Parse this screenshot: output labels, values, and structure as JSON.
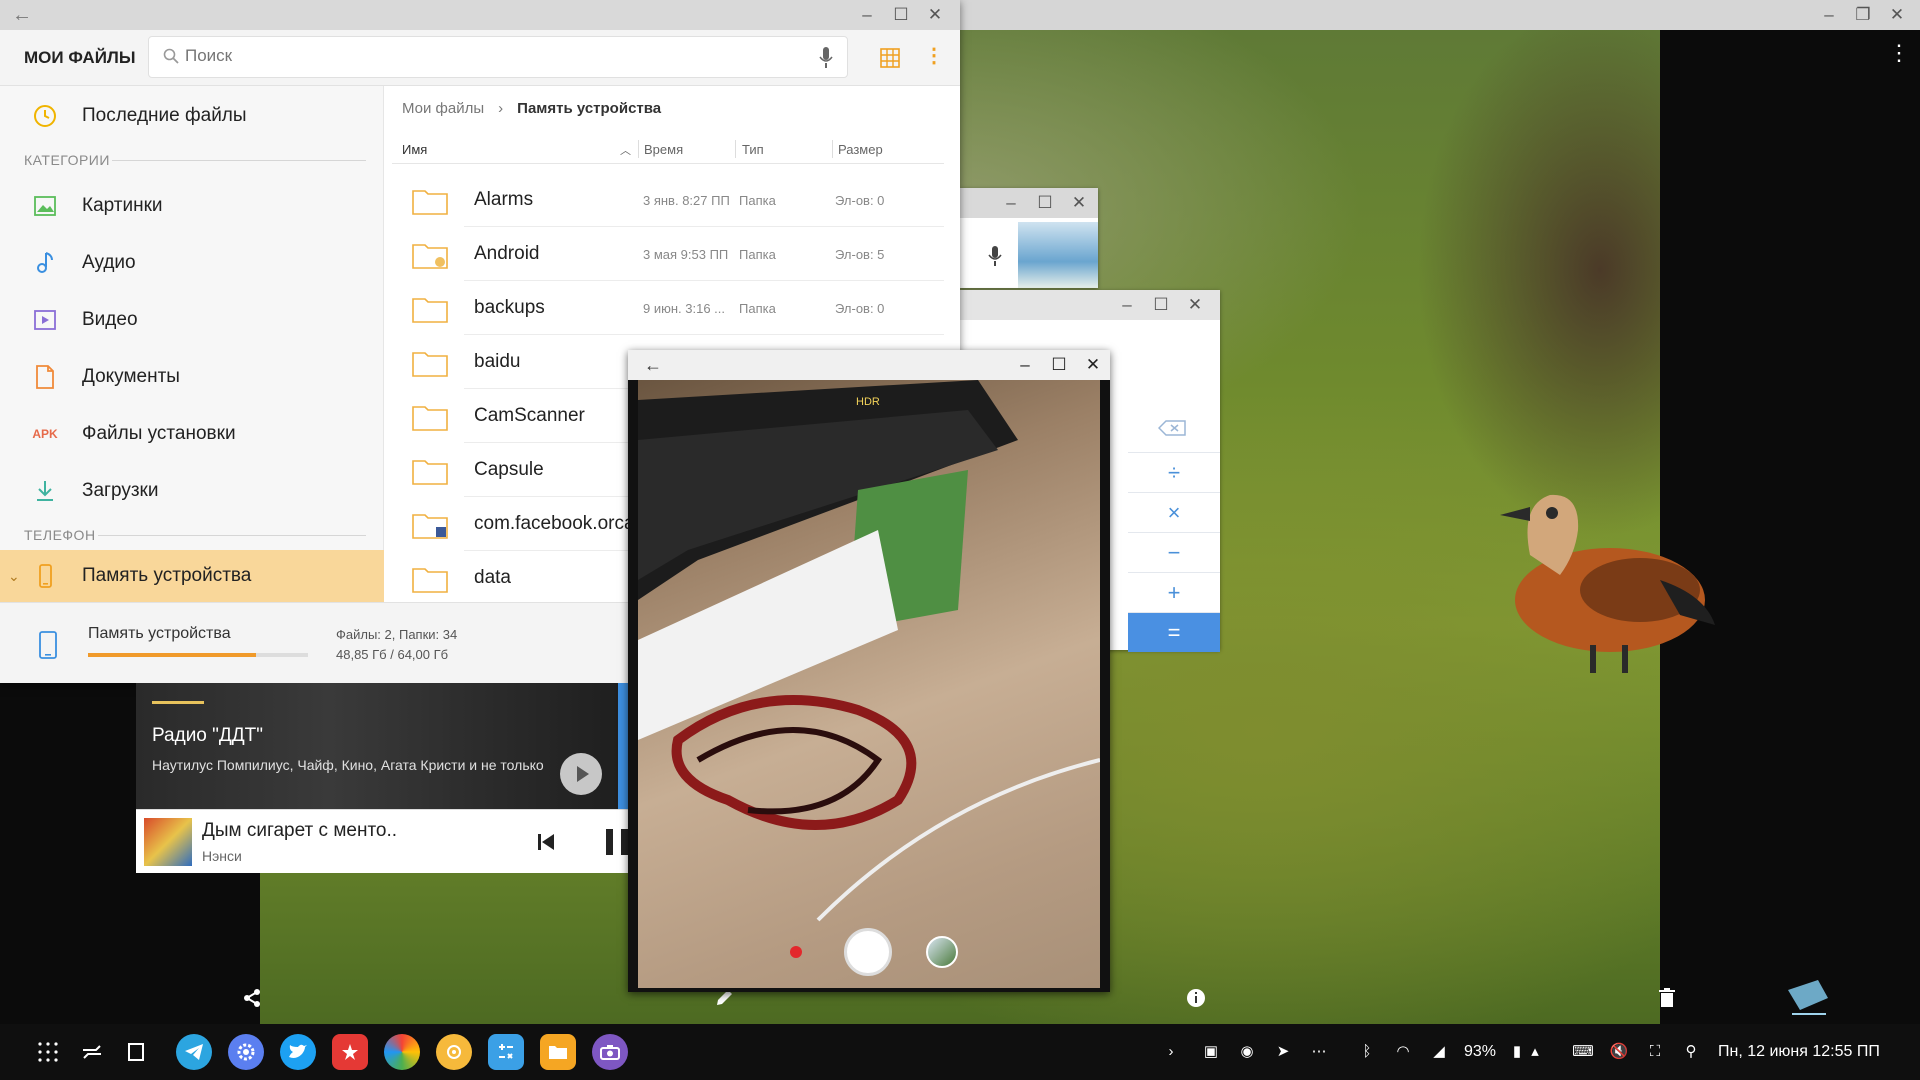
{
  "my_files": {
    "title": "МОИ ФАЙЛЫ",
    "search_placeholder": "Поиск",
    "sidebar": {
      "recent": "Последние файлы",
      "categories_header": "КАТЕГОРИИ",
      "categories": [
        "Картинки",
        "Аудио",
        "Видео",
        "Документы",
        "Файлы установки",
        "Загрузки"
      ],
      "apk_badge": "APK",
      "phone_header": "ТЕЛЕФОН",
      "device_storage": "Память устройства"
    },
    "breadcrumb": [
      "Мои файлы",
      "Память устройства"
    ],
    "columns": {
      "name": "Имя",
      "time": "Время",
      "type": "Тип",
      "size": "Размер"
    },
    "files": [
      {
        "name": "Alarms",
        "date": "3 янв. 8:27 ПП",
        "type": "Папка",
        "size": "Эл-ов: 0"
      },
      {
        "name": "Android",
        "date": "3 мая 9:53 ПП",
        "type": "Папка",
        "size": "Эл-ов: 5"
      },
      {
        "name": "backups",
        "date": "9 июн. 3:16 ...",
        "type": "Папка",
        "size": "Эл-ов: 0"
      },
      {
        "name": "baidu"
      },
      {
        "name": "CamScanner"
      },
      {
        "name": "Capsule"
      },
      {
        "name": "com.facebook.orca"
      },
      {
        "name": "data"
      }
    ],
    "footer": {
      "label": "Память устройства",
      "counts": "Файлы: 2, Папки: 34",
      "size": "48,85 Гб / 64,00 Гб",
      "used_fraction": 0.763
    }
  },
  "music": {
    "station": "Радио \"ДДТ\"",
    "description": "Наутилус Помпилиус, Чайф, Кино, Агата Кристи и не только",
    "track": "Дым сигарет с менто..",
    "artist": "Нэнси"
  },
  "camera": {
    "hdr_label": "HDR"
  },
  "taskbar": {
    "battery": "93%",
    "datetime": "Пн, 12 июня  12:55 ПП"
  },
  "colors": {
    "accent_orange": "#f09a2a",
    "active_row": "#f9d79a",
    "calc_blue": "#4a90e2",
    "record_red": "#e3282c"
  },
  "icons": {
    "sidebar": [
      "clock-icon",
      "image-icon",
      "music-note-icon",
      "video-icon",
      "document-icon",
      "apk-icon",
      "download-icon",
      "phone-icon"
    ],
    "taskbar_apps": [
      "telegram-icon",
      "settings-icon",
      "twitter-icon",
      "bookmark-icon",
      "photos-icon",
      "music-app-icon",
      "calculator-icon",
      "my-files-icon",
      "camera-icon"
    ]
  }
}
